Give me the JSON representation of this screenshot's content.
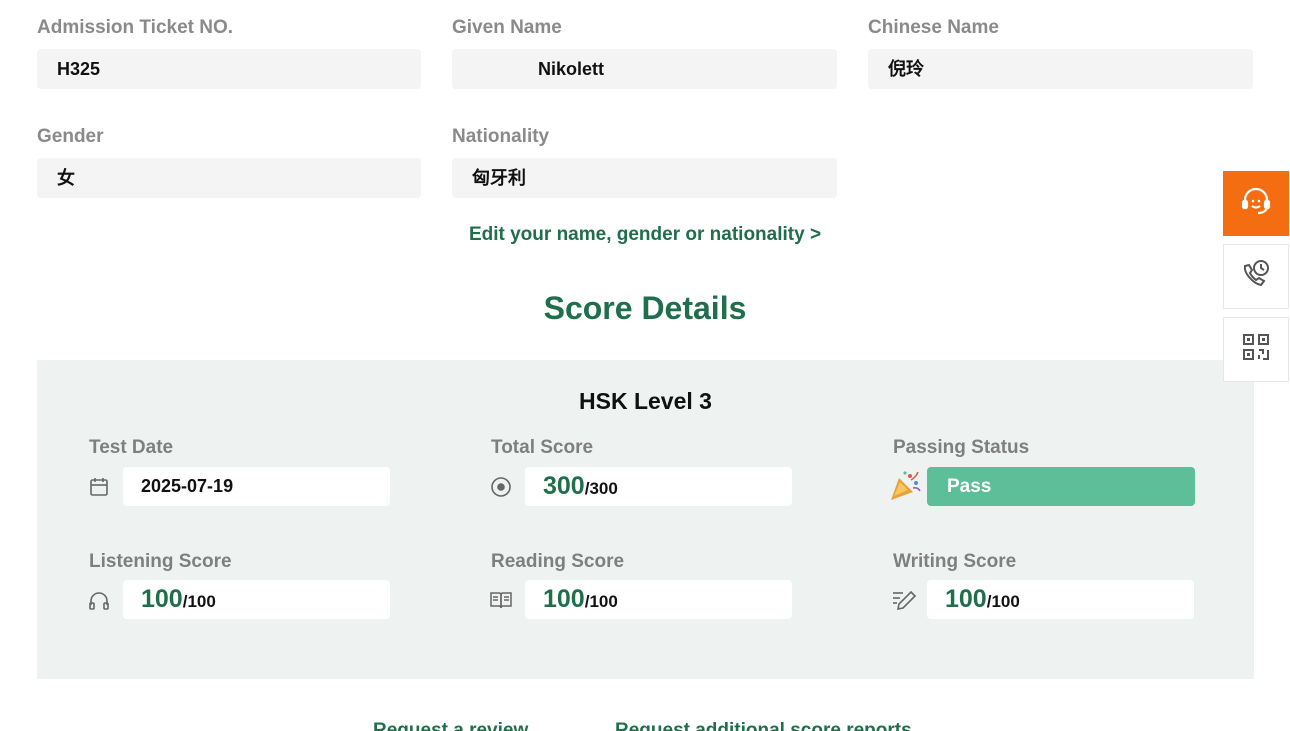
{
  "profile": {
    "ticket_label": "Admission Ticket NO.",
    "ticket_value": "H325",
    "given_name_label": "Given Name",
    "given_name_value": "Nikolett",
    "chinese_name_label": "Chinese Name",
    "chinese_name_value": "倪玲",
    "gender_label": "Gender",
    "gender_value": "女",
    "nationality_label": "Nationality",
    "nationality_value": "匈牙利",
    "edit_link": "Edit your name, gender or nationality >"
  },
  "scores": {
    "section_title": "Score Details",
    "level": "HSK Level 3",
    "test_date_label": "Test Date",
    "test_date_value": "2025-07-19",
    "total_label": "Total Score",
    "total_value": "300",
    "total_max": "/300",
    "passing_label": "Passing Status",
    "passing_value": "Pass",
    "listening_label": "Listening Score",
    "listening_value": "100",
    "listening_max": "/100",
    "reading_label": "Reading Score",
    "reading_value": "100",
    "reading_max": "/100",
    "writing_label": "Writing Score",
    "writing_value": "100",
    "writing_max": "/100"
  },
  "sidebar": {
    "icons": [
      "customer-service-icon",
      "phone-clock-icon",
      "qr-code-icon"
    ],
    "accent": "#f46d10"
  },
  "footer": {
    "review_link": "Request a review",
    "reports_link": "Request additional score reports"
  },
  "colors": {
    "brand_green": "#1f6e4c",
    "pass_green": "#5dbf99",
    "panel_bg": "#eef3f1"
  }
}
